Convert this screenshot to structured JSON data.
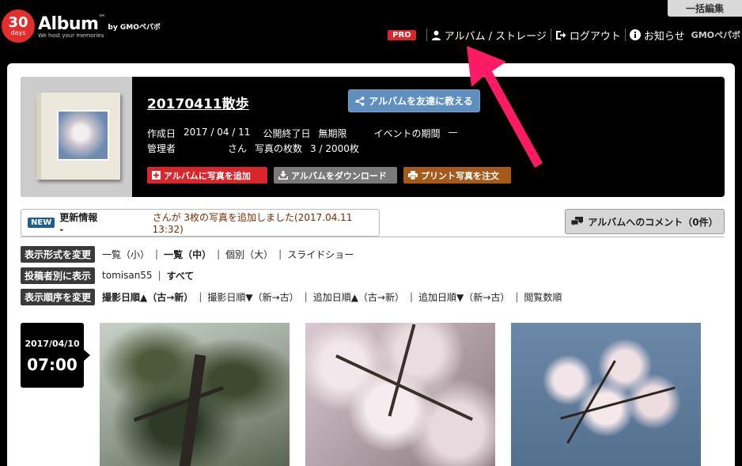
{
  "header": {
    "logo": {
      "number": "30",
      "unit": "days",
      "name": "Album",
      "tm": "™",
      "by": "by GMOペパボ",
      "tagline": "We host your memories"
    },
    "bulk_edit": "一括編集",
    "pro_badge": "PRO",
    "nav": [
      {
        "label": "アルバム / ストレージ",
        "icon": "user-icon"
      },
      {
        "label": "ログアウト",
        "icon": "logout-icon"
      },
      {
        "label": "お知らせ",
        "icon": "info-icon"
      }
    ],
    "gmo": "GMOペパボ"
  },
  "album": {
    "title": "20170411散歩",
    "share_label": "アルバムを友達に教える",
    "created_label": "作成日",
    "created_value": "2017 / 04 / 11",
    "end_label": "公開終了日",
    "end_value": "無期限",
    "event_label": "イベントの期間",
    "event_value": "—",
    "admin_label": "管理者",
    "admin_value": "さん",
    "photos_label": "写真の枚数",
    "photos_value": "3 / 2000枚",
    "add_label": "アルバムに写真を追加",
    "download_label": "アルバムをダウンロード",
    "print_label": "プリント写真を注文"
  },
  "news": {
    "badge": "NEW",
    "label": "更新情報 -",
    "message": "さんが 3枚の写真を追加しました(2017.04.11 13:32)"
  },
  "comment_label": "アルバムへのコメント（0件）",
  "options": {
    "display": {
      "label": "表示形式を変更",
      "items": [
        {
          "text": "一覧（小）",
          "active": false
        },
        {
          "text": "一覧（中）",
          "active": true
        },
        {
          "text": "個別（大）",
          "active": false
        },
        {
          "text": "スライドショー",
          "active": false
        }
      ]
    },
    "poster": {
      "label": "投稿者別に表示",
      "items": [
        {
          "text": "tomisan55",
          "active": false
        },
        {
          "text": "すべて",
          "active": true
        }
      ]
    },
    "order": {
      "label": "表示順序を変更",
      "items": [
        {
          "text": "撮影日順▲（古→新）",
          "active": true
        },
        {
          "text": "撮影日順▼（新→古）",
          "active": false
        },
        {
          "text": "追加日順▲（古→新）",
          "active": false
        },
        {
          "text": "追加日順▼（新→古）",
          "active": false
        },
        {
          "text": "閲覧数順",
          "active": false
        }
      ]
    }
  },
  "photo_group": {
    "date": "2017/04/10",
    "time": "07:00"
  },
  "colors": {
    "accent_red": "#d9262c",
    "share_blue": "#5f8fbf",
    "arrow": "#ff1a66"
  }
}
